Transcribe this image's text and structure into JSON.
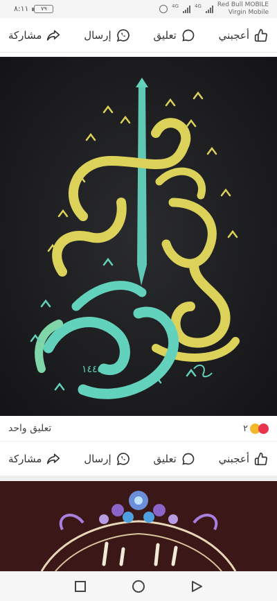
{
  "status_bar": {
    "time": "٨:١١",
    "battery": "٧٩",
    "carrier_line1": "Red Bull MOBILE",
    "carrier_line2": "Virgin Mobile",
    "network_badge": "4G",
    "network_badge2": "4G"
  },
  "actions": {
    "like": "أعجبني",
    "comment": "تعليق",
    "send": "إرسال",
    "share": "مشاركة"
  },
  "post": {
    "comment_count_text": "تعليق واحد",
    "reaction_count": "٢",
    "image_year": "١٤٤٥"
  },
  "colors": {
    "accent_like": "#e53935",
    "reaction_heart": "#e8344e",
    "reaction_laugh": "#f5b72b",
    "calligraphy_yellow": "#dcd25a",
    "calligraphy_teal": "#63d2bd"
  }
}
